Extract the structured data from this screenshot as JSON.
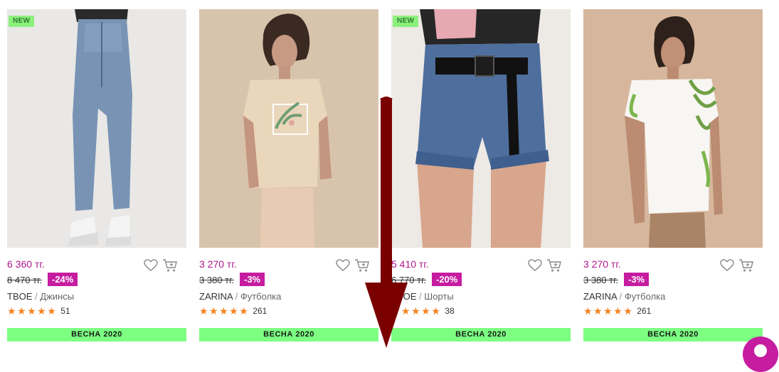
{
  "products": [
    {
      "image_alt": "Женщина в джинсах и белых кроссовках",
      "badge": "NEW",
      "price": "6 360 тг.",
      "old_price": "8 470 тг.",
      "discount": "-24%",
      "brand": "TBOE",
      "separator": "/",
      "category": "Джинсы",
      "stars": "★★★★★",
      "reviews": "51",
      "season": "ВЕСНА 2020"
    },
    {
      "image_alt": "Женщина в бежевой футболке с принтом",
      "badge": "",
      "price": "3 270 тг.",
      "old_price": "3 380 тг.",
      "discount": "-3%",
      "brand": "ZARINA",
      "separator": "/",
      "category": "Футболка",
      "stars": "★★★★★",
      "reviews": "261",
      "season": "ВЕСНА 2020"
    },
    {
      "image_alt": "Джинсовые шорты с ремнем",
      "badge": "NEW",
      "price": "5 410 тг.",
      "old_price": "6 770 тг.",
      "discount": "-20%",
      "brand": "TBOE",
      "separator": "/",
      "category": "Шорты",
      "stars": "★★★★★",
      "reviews": "38",
      "season": "ВЕСНА 2020"
    },
    {
      "image_alt": "Женщина в белой футболке с пальмовыми листьями",
      "badge": "",
      "price": "3 270 тг.",
      "old_price": "3 380 тг.",
      "discount": "-3%",
      "brand": "ZARINA",
      "separator": "/",
      "category": "Футболка",
      "stars": "★★★★★",
      "reviews": "261",
      "season": "ВЕСНА 2020"
    }
  ],
  "colors": {
    "price": "#b0178e",
    "discount_bg": "#c61ca0",
    "season_bg": "#7dff82",
    "star": "#f5821f",
    "new_badge_bg": "#8bf07c",
    "arrow": "#7a0000"
  },
  "icons": {
    "favorite": "heart-outline-icon",
    "cart": "shopping-cart-icon",
    "chat": "chat-bubble-icon",
    "scroll_hint": "down-arrow-icon"
  }
}
